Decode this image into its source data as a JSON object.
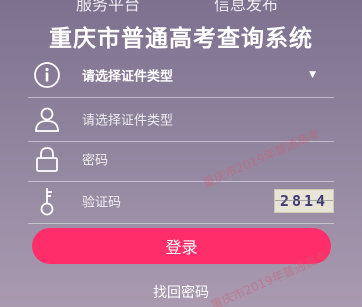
{
  "top_nav": {
    "left": "服务平台",
    "right": "信息发布"
  },
  "title": "重庆市普通高考查询系统",
  "form": {
    "id_type": {
      "value": "请选择证件类型",
      "icon": "info-circle-icon"
    },
    "id_number": {
      "placeholder": "请选择证件类型",
      "icon": "user-icon"
    },
    "password": {
      "placeholder": "密码",
      "icon": "lock-icon"
    },
    "captcha": {
      "placeholder": "验证码",
      "icon": "key-icon",
      "image_text": "2814"
    }
  },
  "login_label": "登录",
  "forgot_label": "找回密码",
  "watermark": "重庆市2019年普通高考",
  "colors": {
    "accent": "#ff2e6b",
    "background": "#8b7f9a"
  }
}
